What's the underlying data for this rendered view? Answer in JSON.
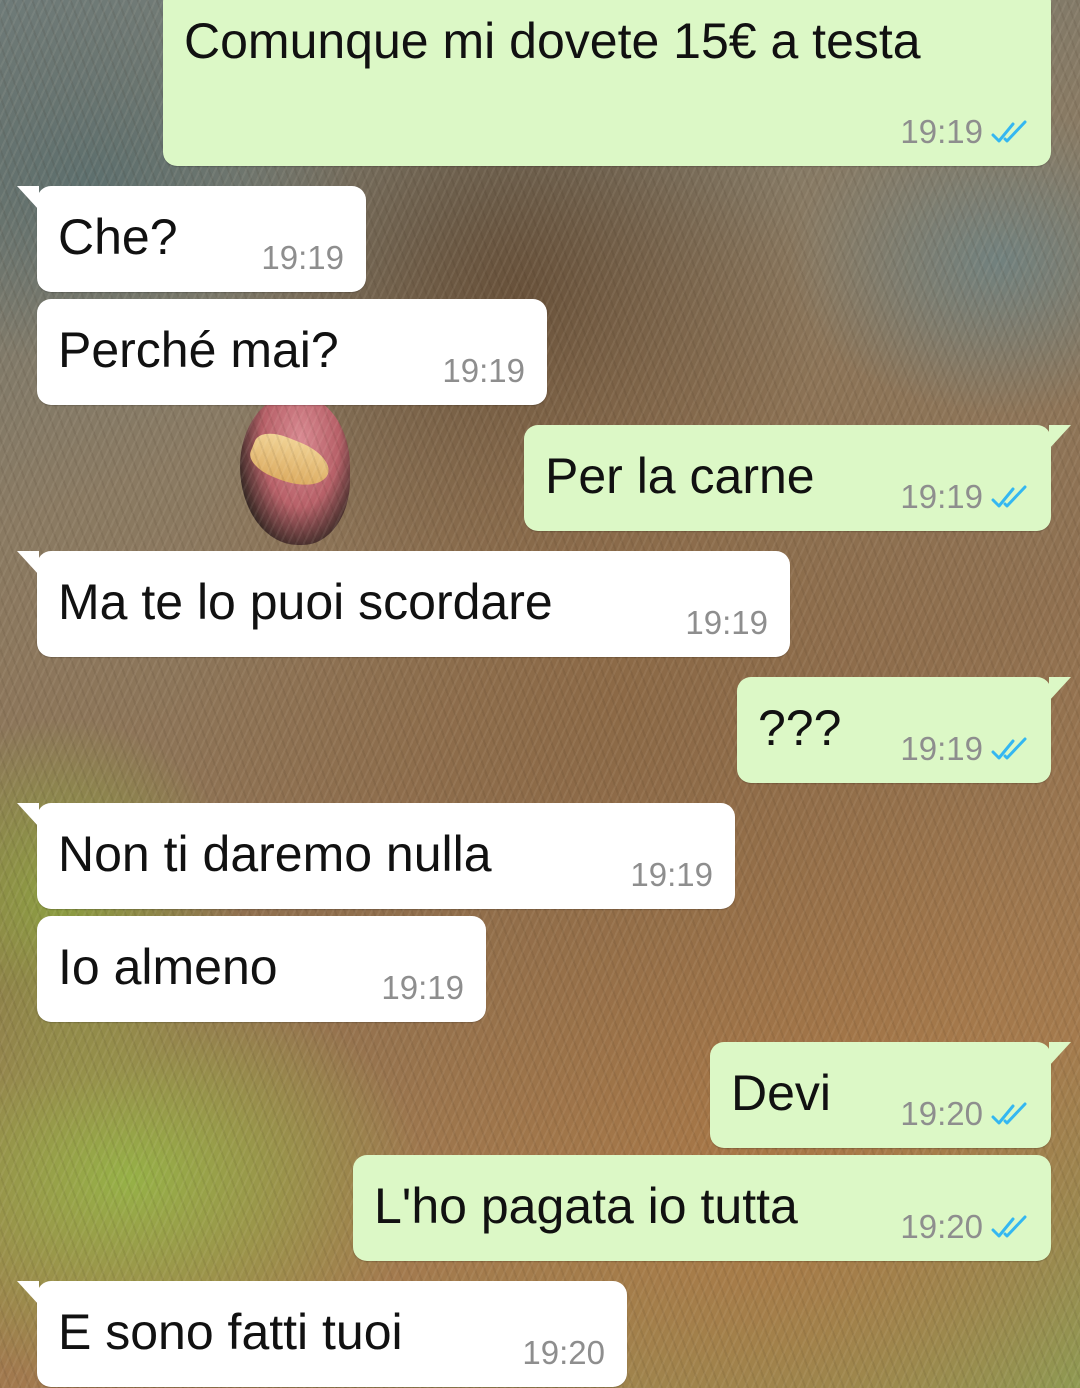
{
  "colors": {
    "outgoing_bubble": "#dcf8c6",
    "incoming_bubble": "#ffffff",
    "timestamp": "#8e8e8e",
    "read_ticks": "#34b7f1"
  },
  "icons": {
    "read_receipt": "double-check-icon"
  },
  "messages": [
    {
      "direction": "outgoing",
      "text": "Comunque mi dovete 15€ a testa",
      "time": "19:19",
      "read": true
    },
    {
      "direction": "incoming",
      "text": "Che?",
      "time": "19:19"
    },
    {
      "direction": "incoming",
      "text": "Perché mai?",
      "time": "19:19"
    },
    {
      "direction": "outgoing",
      "text": "Per la carne",
      "time": "19:19",
      "read": true
    },
    {
      "direction": "incoming",
      "text": "Ma te lo puoi scordare",
      "time": "19:19"
    },
    {
      "direction": "outgoing",
      "text": "???",
      "time": "19:19",
      "read": true
    },
    {
      "direction": "incoming",
      "text": "Non ti daremo nulla",
      "time": "19:19"
    },
    {
      "direction": "incoming",
      "text": "Io almeno",
      "time": "19:19"
    },
    {
      "direction": "outgoing",
      "text": "Devi",
      "time": "19:20",
      "read": true
    },
    {
      "direction": "outgoing",
      "text": "L'ho pagata io tutta",
      "time": "19:20",
      "read": true
    },
    {
      "direction": "incoming",
      "text": "E sono fatti tuoi",
      "time": "19:20"
    }
  ]
}
